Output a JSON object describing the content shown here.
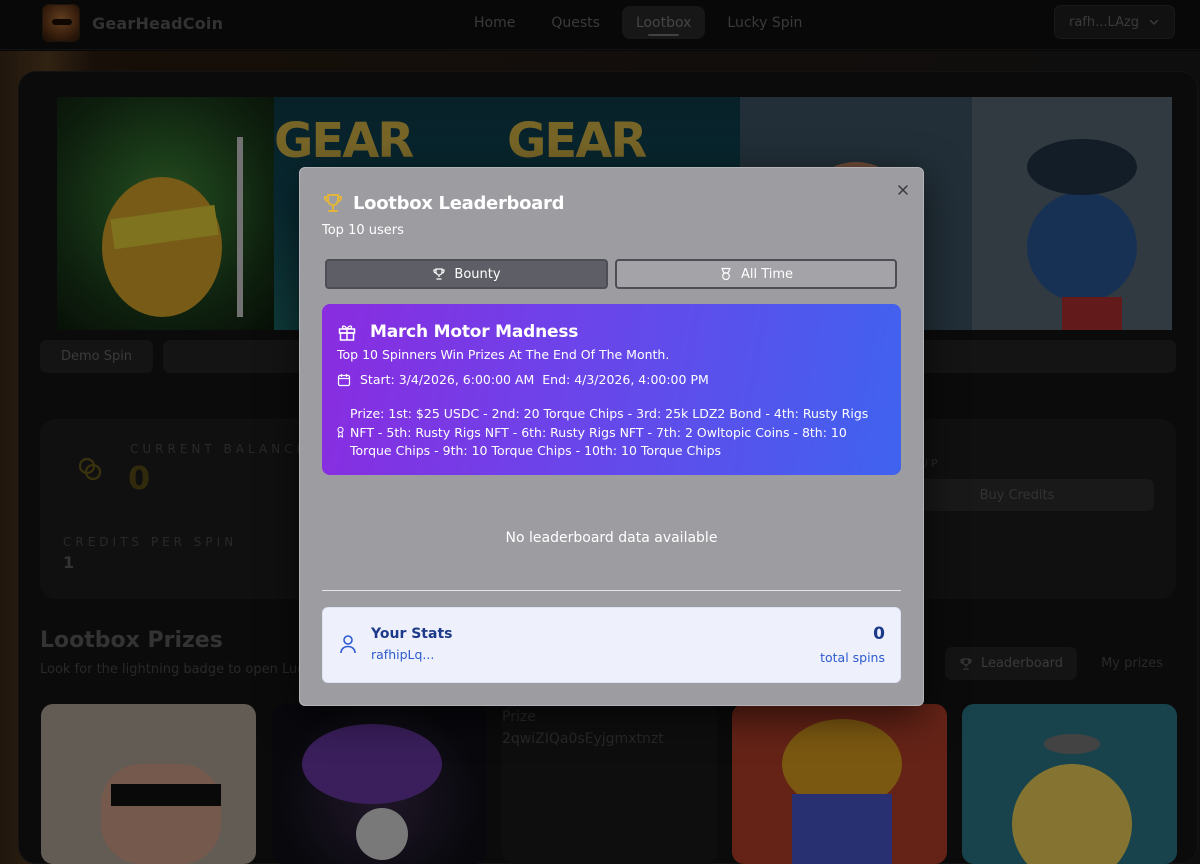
{
  "navbar": {
    "brand": "GearHeadCoin",
    "links": [
      {
        "label": "Home",
        "active": false
      },
      {
        "label": "Quests",
        "active": false
      },
      {
        "label": "Lootbox",
        "active": true
      },
      {
        "label": "Lucky Spin",
        "active": false
      }
    ],
    "wallet": "rafh...LAzg"
  },
  "art_banner": {
    "tile2_text": "GEAR",
    "tile3_text": "GEAR"
  },
  "page": {
    "demo_spin": "Demo Spin",
    "balance_label": "CURRENT BALANCE",
    "balance_value": "0",
    "credits_per_spin_label": "CREDITS PER SPIN",
    "credits_per_spin_value": "1",
    "topup_label": "UP",
    "buy_credits": "Buy Credits",
    "prizes_title": "Lootbox Prizes",
    "prizes_subtitle": "Look for the lightning badge to open Lucky",
    "leaderboard_button": "Leaderboard",
    "my_prizes_button": "My prizes",
    "prize_alt_line1": "Prize",
    "prize_alt_line2": "2qwiZIQa0sEyjgmxtnzt"
  },
  "modal": {
    "title": "Lootbox Leaderboard",
    "subtitle": "Top 10 users",
    "tabs": [
      {
        "label": "Bounty",
        "active": true
      },
      {
        "label": "All Time",
        "active": false
      }
    ],
    "bounty": {
      "title": "March Motor Madness",
      "description": "Top 10 Spinners Win Prizes At The End Of The Month.",
      "dates": "Start: 3/4/2026, 6:00:00 AM  End: 4/3/2026, 4:00:00 PM",
      "prize": "Prize: 1st: $25 USDC - 2nd: 20 Torque Chips - 3rd: 25k LDZ2 Bond - 4th: Rusty Rigs NFT - 5th: Rusty Rigs NFT - 6th: Rusty Rigs NFT - 7th: 2 Owltopic Coins - 8th: 10 Torque Chips - 9th: 10 Torque Chips - 10th: 10 Torque Chips"
    },
    "empty_message": "No leaderboard data available",
    "stats": {
      "title": "Your Stats",
      "user": "rafhipLq...",
      "value": "0",
      "unit": "total spins"
    }
  },
  "colors": {
    "modal_bg": "#9c9ca1",
    "bounty_gradient_start": "#8a2ce0",
    "bounty_gradient_end": "#3f63ee",
    "stats_bg": "#eef1fb",
    "stats_accent": "#1d3a8a",
    "trophy_gold": "#e3b53a"
  },
  "icons": {
    "modal_title": "trophy-icon",
    "bounty_tab": "trophy-icon",
    "alltime_tab": "medal-icon",
    "bounty_title": "gift-icon",
    "bounty_dates": "calendar-icon",
    "bounty_prize": "award-icon",
    "stats": "user-icon",
    "close": "close-icon",
    "wallet": "chevron-down-icon",
    "balance": "coins-icon"
  }
}
